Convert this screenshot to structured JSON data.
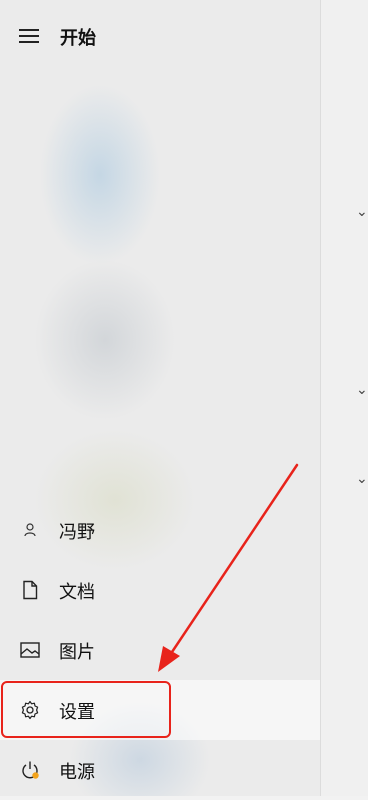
{
  "start_menu": {
    "title": "开始",
    "menu_icon": "hamburger-menu-icon",
    "items": [
      {
        "label": "冯野",
        "icon": "user-icon"
      },
      {
        "label": "文档",
        "icon": "document-icon"
      },
      {
        "label": "图片",
        "icon": "picture-icon"
      },
      {
        "label": "设置",
        "icon": "gear-icon",
        "selected": true
      },
      {
        "label": "电源",
        "icon": "power-icon"
      }
    ]
  },
  "annotation": {
    "color": "#e8231b"
  }
}
